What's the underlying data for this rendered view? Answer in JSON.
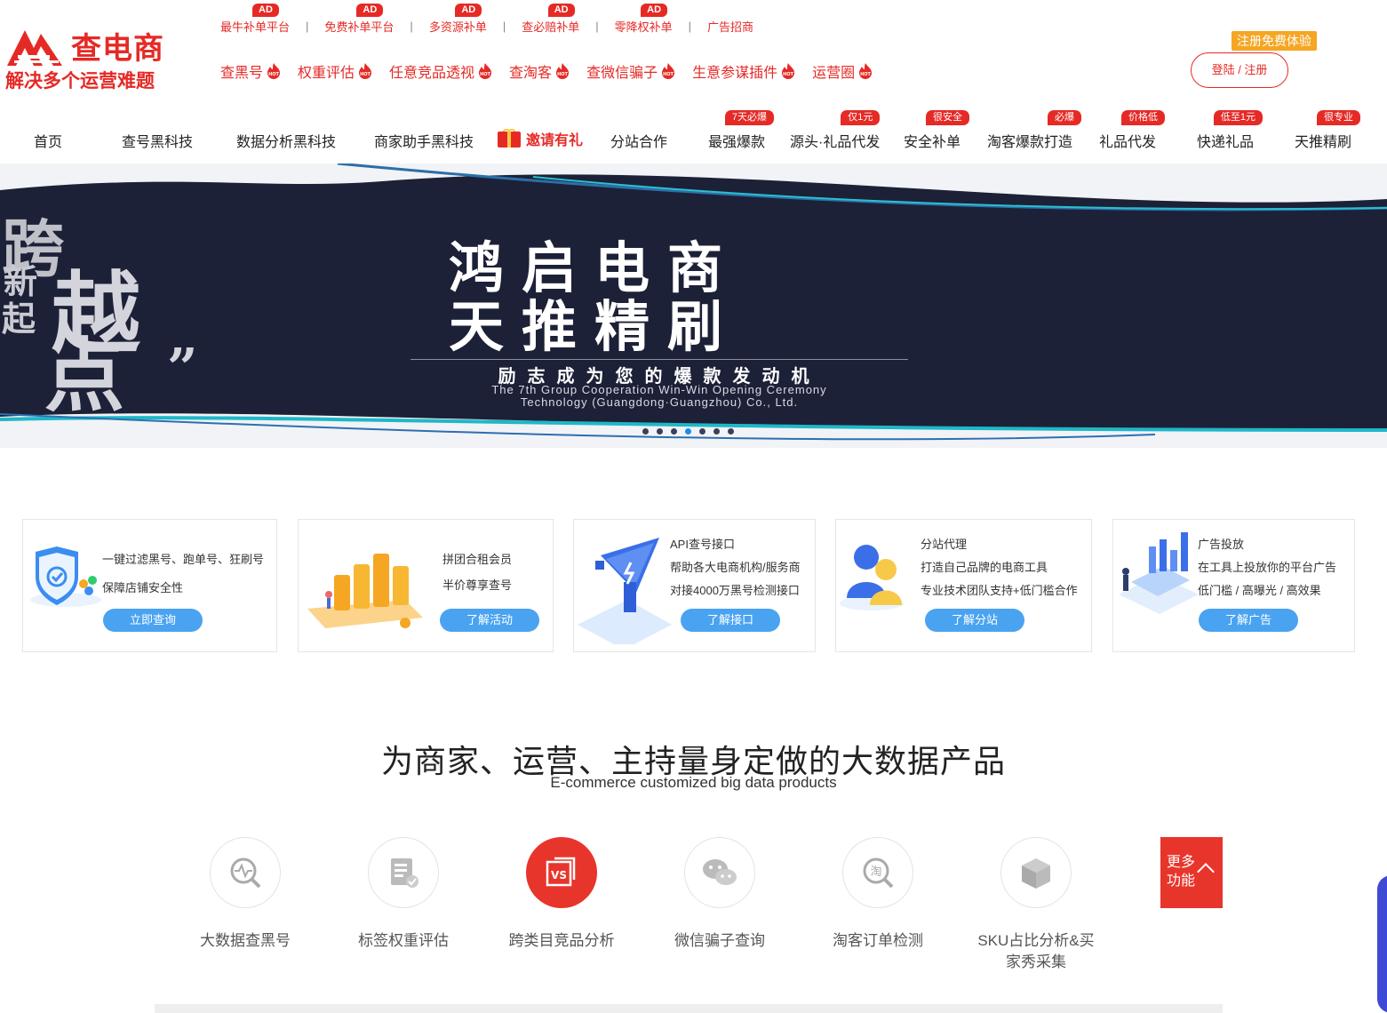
{
  "brand": {
    "name": "查电商",
    "slogan": "解决多个运营难题",
    "color": "#e52a26"
  },
  "top_links": [
    {
      "label": "最牛补单平台",
      "badge": "AD"
    },
    {
      "label": "免费补单平台",
      "badge": "AD"
    },
    {
      "label": "多资源补单",
      "badge": "AD"
    },
    {
      "label": "查必赔补单",
      "badge": "AD"
    },
    {
      "label": "零降权补单",
      "badge": "AD"
    },
    {
      "label": "广告招商",
      "badge": ""
    }
  ],
  "hot_links": [
    "查黑号",
    "权重评估",
    "任意竞品透视",
    "查淘客",
    "查微信骗子",
    "生意参谋插件",
    "运营圈"
  ],
  "account": {
    "free_tag": "注册免费体验",
    "login_label": "登陆 / 注册"
  },
  "nav": [
    {
      "label": "首页",
      "badge": ""
    },
    {
      "label": "查号黑科技",
      "badge": ""
    },
    {
      "label": "数据分析黑科技",
      "badge": ""
    },
    {
      "label": "商家助手黑科技",
      "badge": ""
    },
    {
      "label": "邀请有礼",
      "badge": ""
    },
    {
      "label": "分站合作",
      "badge": ""
    },
    {
      "label": "最强爆款",
      "badge": "7天必爆"
    },
    {
      "label": "源头·礼品代发",
      "badge": "仅1元"
    },
    {
      "label": "安全补单",
      "badge": "很安全"
    },
    {
      "label": "淘客爆款打造",
      "badge": "必爆"
    },
    {
      "label": "礼品代发",
      "badge": "价格低"
    },
    {
      "label": "快递礼品",
      "badge": "低至1元"
    },
    {
      "label": "天推精刷",
      "badge": "很专业"
    }
  ],
  "banner": {
    "line1": "鸿启电商",
    "line2": "天推精刷",
    "subtitle": "励志成为您的爆款发动机",
    "english_1": "The 7th Group Cooperation Win-Win Opening Ceremony",
    "english_2": "Technology (Guangdong·Guangzhou) Co., Ltd.",
    "art_1": "跨",
    "art_2": "新",
    "art_3": "起",
    "art_4": "越",
    "art_5": "点",
    "slides": 7,
    "active_slide": 4
  },
  "cards": [
    {
      "lines": [
        "一键过滤黑号、跑单号、狂刷号",
        "保障店铺安全性"
      ],
      "button": "立即查询"
    },
    {
      "lines": [
        "拼团合租会员",
        "半价尊享查号"
      ],
      "button": "了解活动"
    },
    {
      "lines": [
        "API查号接口",
        "帮助各大电商机构/服务商",
        "对接4000万黑号检测接口"
      ],
      "button": "了解接口"
    },
    {
      "lines": [
        "分站代理",
        "打造自己品牌的电商工具",
        "专业技术团队支持+低门槛合作"
      ],
      "button": "了解分站"
    },
    {
      "lines": [
        "广告投放",
        "在工具上投放你的平台广告",
        "低门槛 / 高曝光 / 高效果"
      ],
      "button": "了解广告"
    }
  ],
  "section": {
    "title": "为商家、运营、主持量身定做的大数据产品",
    "subtitle": "E-commerce customized big data products"
  },
  "products": [
    {
      "label": "大数据查黑号",
      "icon": "search-pulse-icon"
    },
    {
      "label": "标签权重评估",
      "icon": "document-check-icon"
    },
    {
      "label": "跨类目竞品分析",
      "icon": "vs-icon"
    },
    {
      "label": "微信骗子查询",
      "icon": "wechat-icon"
    },
    {
      "label": "淘客订单检测",
      "icon": "taobao-search-icon"
    },
    {
      "label_1": "SKU占比分析&买",
      "label_2": "家秀采集",
      "icon": "cube-icon"
    }
  ],
  "more": {
    "line1": "更多",
    "line2": "功能"
  }
}
